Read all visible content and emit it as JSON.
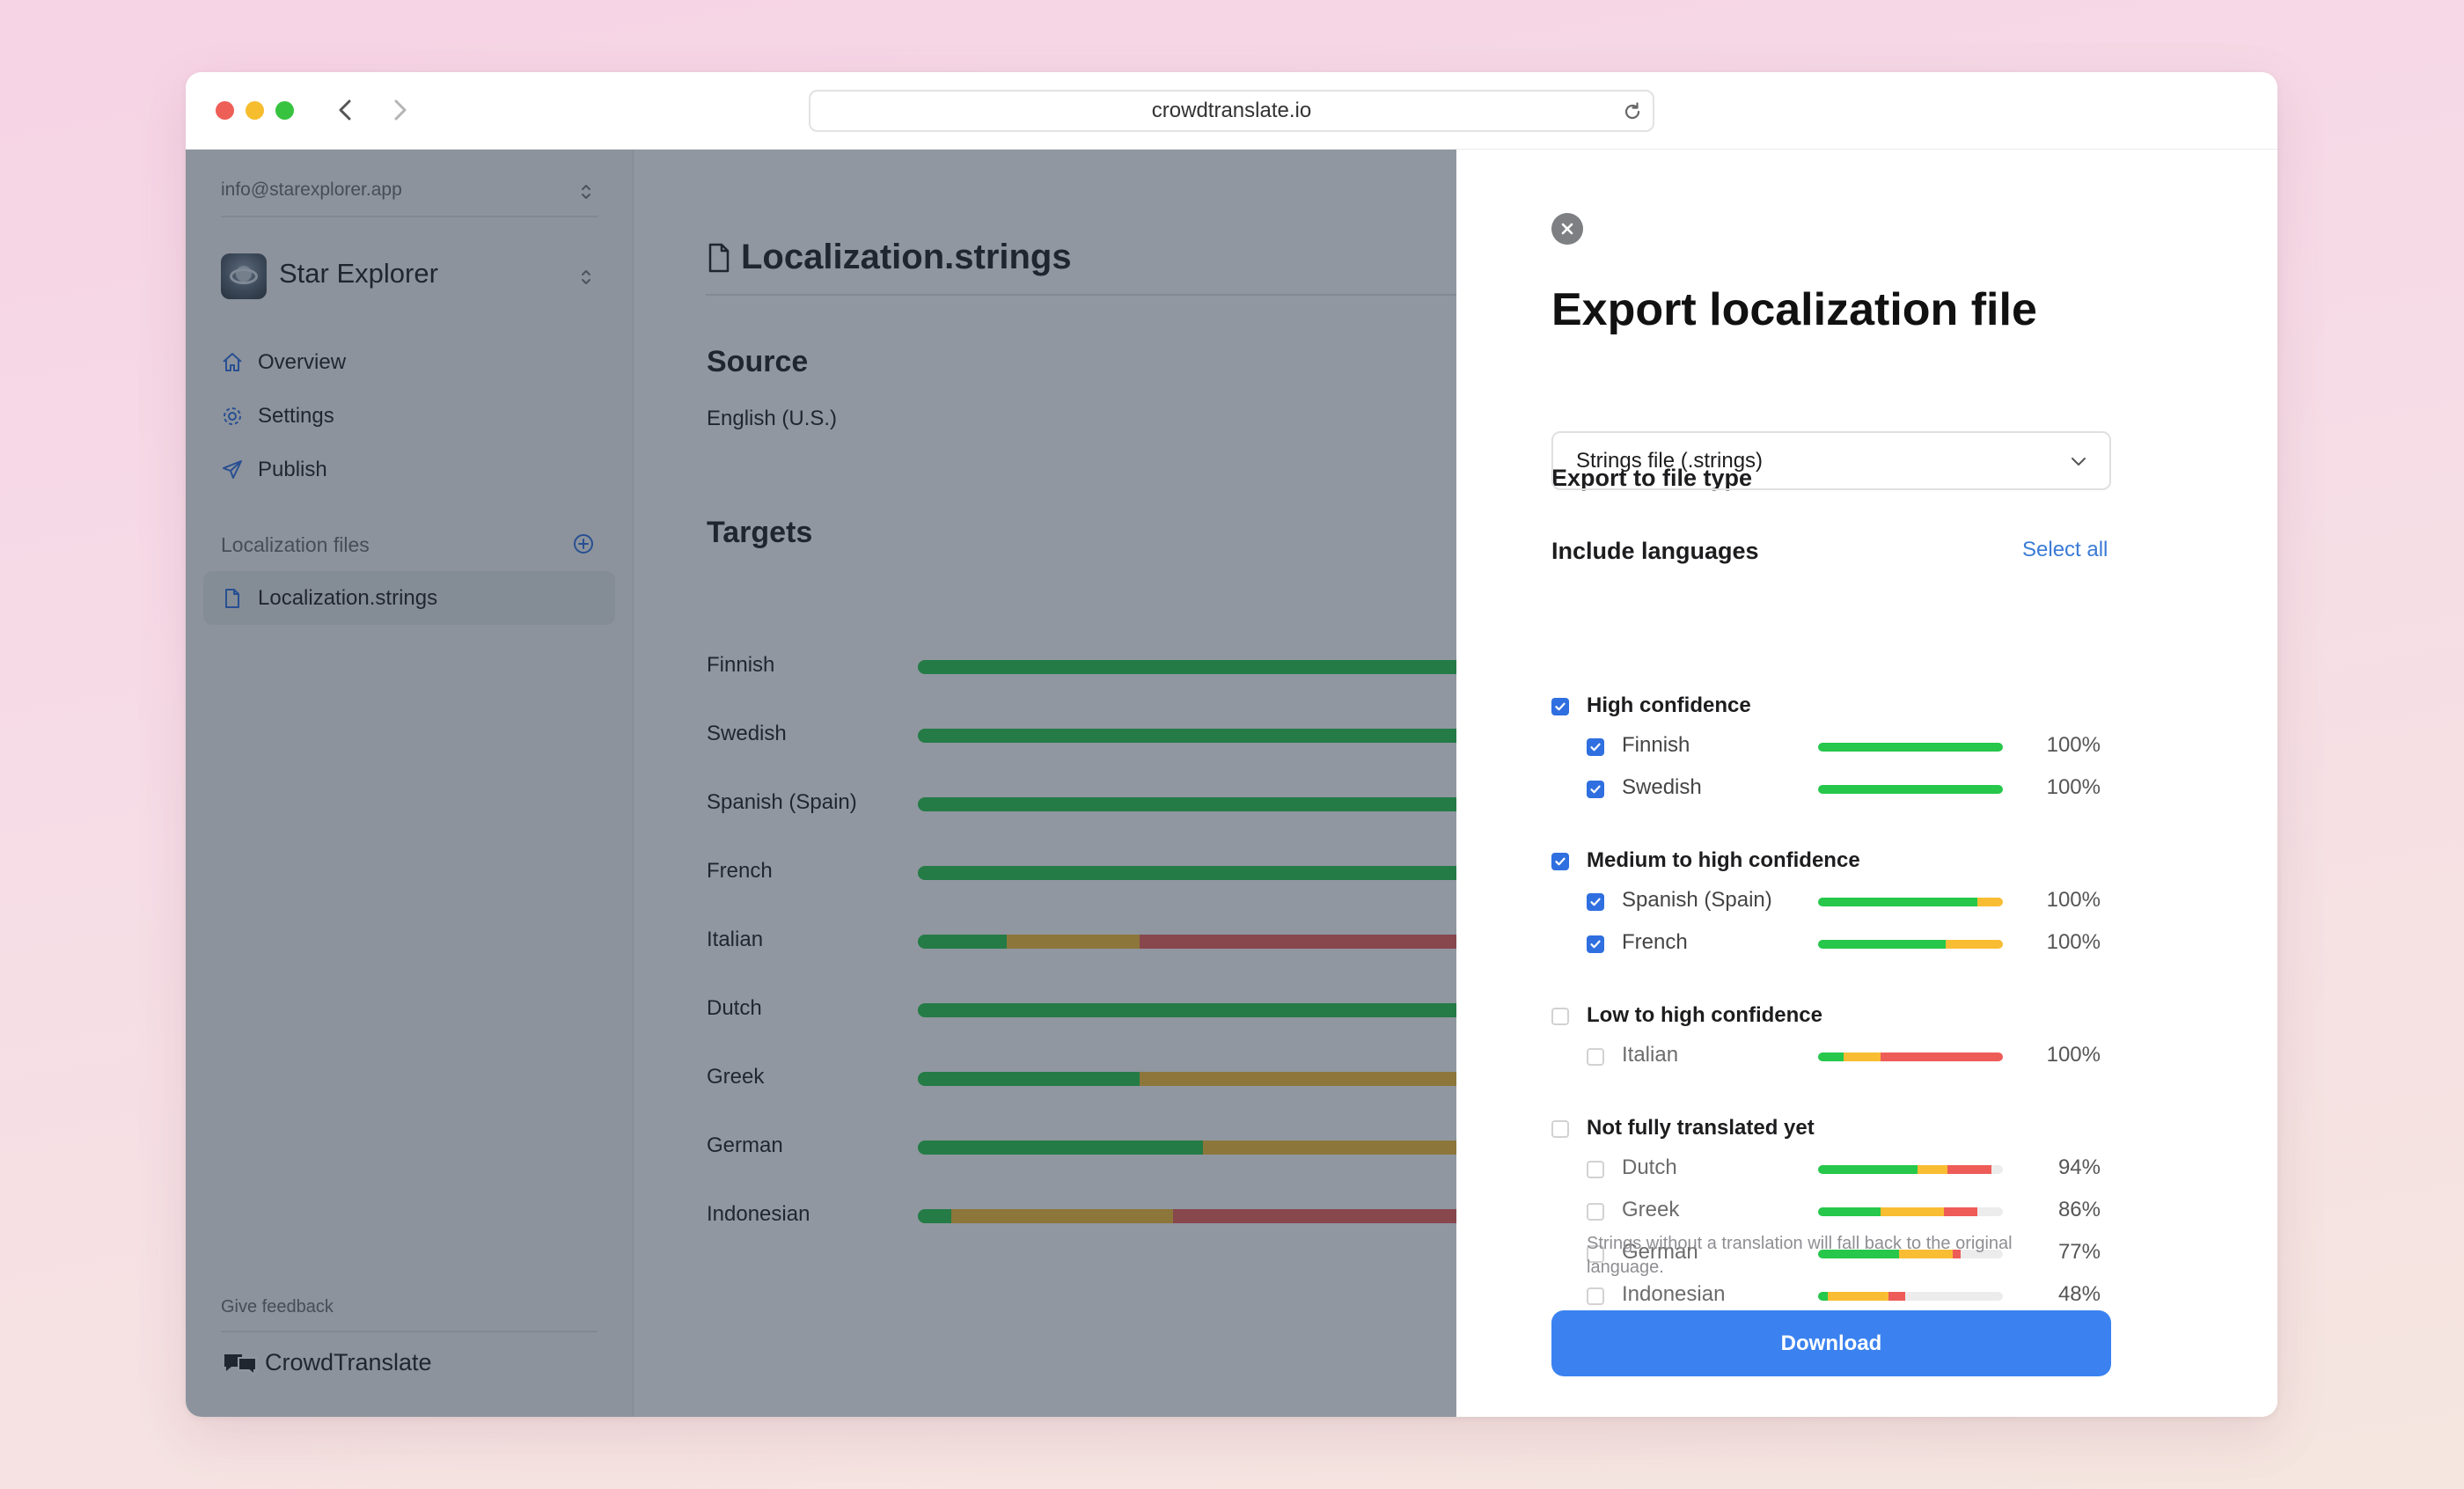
{
  "browser": {
    "url": "crowdtranslate.io"
  },
  "sidebar": {
    "account": "info@starexplorer.app",
    "app_name": "Star Explorer",
    "nav": [
      {
        "label": "Overview",
        "icon": "home-icon"
      },
      {
        "label": "Settings",
        "icon": "gear-icon"
      },
      {
        "label": "Publish",
        "icon": "send-icon"
      }
    ],
    "section_label": "Localization files",
    "files": [
      {
        "label": "Localization.strings",
        "icon": "file-icon"
      }
    ],
    "feedback": "Give feedback",
    "brand": "CrowdTranslate"
  },
  "main": {
    "title": "Localization.strings",
    "source_heading": "Source",
    "source_value": "English (U.S.)",
    "targets_heading": "Targets",
    "targets": [
      {
        "label": "Finnish",
        "high": 100,
        "medium": 0,
        "low": 0
      },
      {
        "label": "Swedish",
        "high": 100,
        "medium": 0,
        "low": 0
      },
      {
        "label": "Spanish (Spain)",
        "high": 100,
        "medium": 0,
        "low": 0
      },
      {
        "label": "French",
        "high": 100,
        "medium": 0,
        "low": 0
      },
      {
        "label": "Italian",
        "high": 8.4,
        "medium": 12.6,
        "low": 79
      },
      {
        "label": "Dutch",
        "high": 100,
        "medium": 0,
        "low": 0
      },
      {
        "label": "Greek",
        "high": 21,
        "medium": 79,
        "low": 0
      },
      {
        "label": "German",
        "high": 27,
        "medium": 73,
        "low": 0
      },
      {
        "label": "Indonesian",
        "high": 3.2,
        "medium": 21,
        "low": 75.8
      }
    ]
  },
  "panel": {
    "title": "Export localization file",
    "file_type_label": "Export to file type",
    "file_type_value": "Strings file (.strings)",
    "include_label": "Include languages",
    "select_all": "Select all",
    "groups": [
      {
        "label": "High confidence",
        "checked": true,
        "languages": [
          {
            "label": "Finnish",
            "checked": true,
            "high": 100,
            "medium": 0,
            "low": 0,
            "percent": "100%"
          },
          {
            "label": "Swedish",
            "checked": true,
            "high": 100,
            "medium": 0,
            "low": 0,
            "percent": "100%"
          }
        ]
      },
      {
        "label": "Medium to high confidence",
        "checked": true,
        "languages": [
          {
            "label": "Spanish (Spain)",
            "checked": true,
            "high": 86,
            "medium": 14,
            "low": 0,
            "percent": "100%"
          },
          {
            "label": "French",
            "checked": true,
            "high": 69,
            "medium": 31,
            "low": 0,
            "percent": "100%"
          }
        ]
      },
      {
        "label": "Low to high confidence",
        "checked": false,
        "languages": [
          {
            "label": "Italian",
            "checked": false,
            "high": 14,
            "medium": 20,
            "low": 66,
            "percent": "100%"
          }
        ]
      },
      {
        "label": "Not fully translated yet",
        "checked": false,
        "languages": [
          {
            "label": "Dutch",
            "checked": false,
            "high": 54,
            "medium": 16,
            "low": 24,
            "percent": "94%"
          },
          {
            "label": "Greek",
            "checked": false,
            "high": 34,
            "medium": 34,
            "low": 18,
            "percent": "86%"
          },
          {
            "label": "German",
            "checked": false,
            "high": 44,
            "medium": 29,
            "low": 4,
            "percent": "77%"
          },
          {
            "label": "Indonesian",
            "checked": false,
            "high": 5,
            "medium": 33,
            "low": 9,
            "percent": "48%"
          }
        ]
      }
    ],
    "footnote": "Strings without a translation will fall back to the original language.",
    "download": "Download"
  },
  "colors": {
    "high": "#26c74a",
    "medium": "#f9bd33",
    "low": "#ee5c58",
    "accent": "#3b82f0",
    "track": "#ececec"
  }
}
